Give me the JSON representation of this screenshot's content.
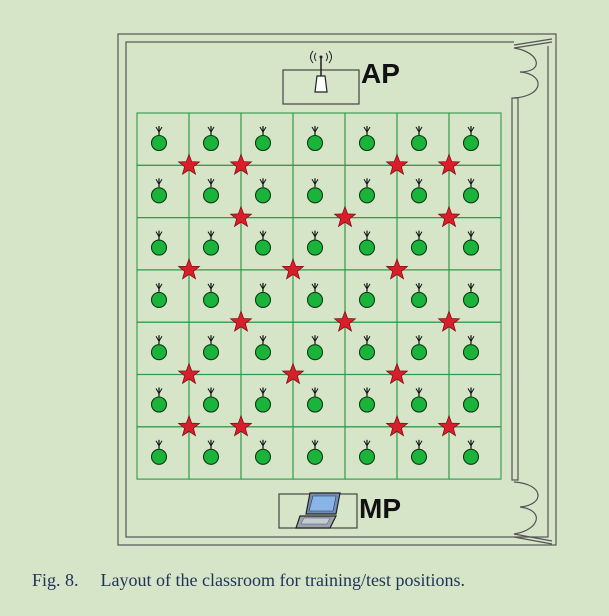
{
  "diagram": {
    "ap_label": "AP",
    "mp_label": "MP",
    "grid": {
      "rows": 7,
      "cols": 7
    },
    "colors": {
      "background": "#d6e4c8",
      "grid_line": "#2e9a4a",
      "sensor_fill": "#1bb43a",
      "star_fill": "#d81e2a",
      "wall": "#555555"
    },
    "test_positions": [
      [
        1,
        1
      ],
      [
        1,
        2
      ],
      [
        1,
        5
      ],
      [
        1,
        6
      ],
      [
        2,
        2
      ],
      [
        2,
        4
      ],
      [
        2,
        6
      ],
      [
        3,
        1
      ],
      [
        3,
        3
      ],
      [
        3,
        5
      ],
      [
        4,
        2
      ],
      [
        4,
        4
      ],
      [
        4,
        6
      ],
      [
        5,
        1
      ],
      [
        5,
        3
      ],
      [
        5,
        5
      ],
      [
        6,
        1
      ],
      [
        6,
        2
      ],
      [
        6,
        5
      ],
      [
        6,
        6
      ]
    ]
  },
  "caption": {
    "number": "Fig. 8.",
    "text": "Layout of the classroom for training/test positions."
  }
}
